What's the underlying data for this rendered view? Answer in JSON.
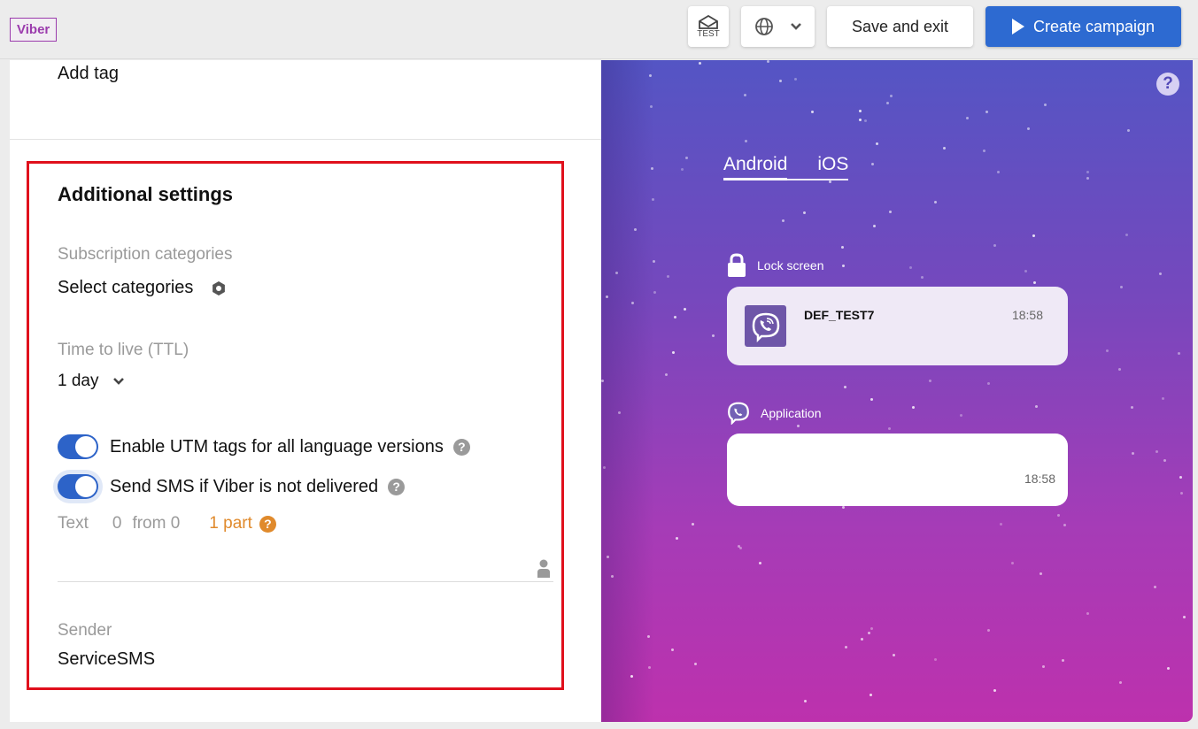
{
  "header": {
    "channel": "Viber",
    "test_label": "TEST",
    "language_icon": "globe-icon",
    "save_label": "Save and exit",
    "create_label": "Create campaign",
    "colors": {
      "create_bg": "#2d6ad1",
      "channel_badge": "#9b3bad"
    }
  },
  "left": {
    "add_tag": "Add tag",
    "section_title": "Additional settings",
    "subscription": {
      "label": "Subscription categories",
      "value": "Select categories"
    },
    "ttl": {
      "label": "Time to live (TTL)",
      "value": "1 day"
    },
    "toggles": [
      {
        "label": "Enable UTM tags for all language versions",
        "on": true
      },
      {
        "label": "Send SMS if Viber is not delivered",
        "on": true
      }
    ],
    "sms": {
      "text_label": "Text",
      "count": "0",
      "from": "from 0",
      "parts": "1 part",
      "value": ""
    },
    "sender": {
      "label": "Sender",
      "value": "ServiceSMS"
    },
    "colors": {
      "toggle_on": "#2d63c8",
      "parts": "#e08a2c",
      "highlight_border": "#e0101c"
    }
  },
  "preview": {
    "help": "?",
    "tabs": [
      {
        "label": "Android",
        "active": true
      },
      {
        "label": "iOS",
        "active": false
      }
    ],
    "lock_screen": {
      "label": "Lock screen",
      "sender": "DEF_TEST7",
      "time": "18:58"
    },
    "application": {
      "label": "Application",
      "time": "18:58"
    }
  }
}
